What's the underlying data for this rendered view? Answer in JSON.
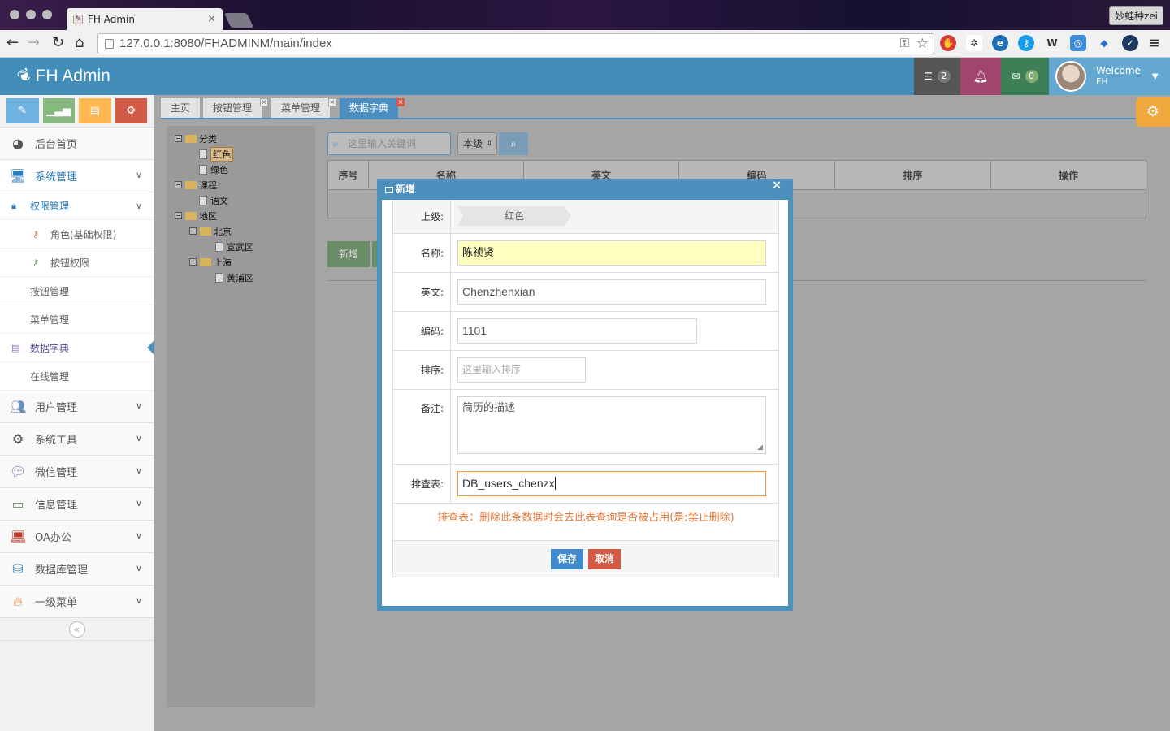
{
  "browser": {
    "tab_title": "FH Admin",
    "tab_close": "×",
    "profile_name": "妙蛙种zei",
    "url": "127.0.0.1:8080/FHADMINM/main/index"
  },
  "navbar": {
    "brand": "FH Admin",
    "tasks_count": "2",
    "messages_count": "0",
    "welcome": "Welcome",
    "username": "FH",
    "colors": {
      "bar": "#438eb9",
      "tasks": "#555555",
      "bell": "#a0456e",
      "mail": "#3d7f56",
      "user": "#62a8d1"
    }
  },
  "sidebar": {
    "shortcuts": [
      {
        "icon": "pencil-icon",
        "color": "#6fb3e0"
      },
      {
        "icon": "signal-icon",
        "color": "#87b87f"
      },
      {
        "icon": "book-icon",
        "color": "#ffb752"
      },
      {
        "icon": "cogs-icon",
        "color": "#d15b47"
      }
    ],
    "home": "后台首页",
    "system": "系统管理",
    "permissions": "权限管理",
    "role": "角色(基础权限)",
    "button_perm": "按钮权限",
    "button_mgmt": "按钮管理",
    "menu_mgmt": "菜单管理",
    "dictionary": "数据字典",
    "online": "在线管理",
    "users": "用户管理",
    "tools": "系统工具",
    "wechat": "微信管理",
    "info": "信息管理",
    "oa": "OA办公",
    "database": "数据库管理",
    "level1": "一级菜单",
    "collapse_glyph": "«"
  },
  "tabs": [
    "主页",
    "按钮管理",
    "菜单管理",
    "数据字典"
  ],
  "tree": {
    "category": "分类",
    "red": "红色",
    "green": "绿色",
    "course": "课程",
    "chinese": "语文",
    "region": "地区",
    "beijing": "北京",
    "xuanwu": "宣武区",
    "shanghai": "上海",
    "huangpu": "黄浦区"
  },
  "search": {
    "placeholder": "这里输入关键词",
    "level": "本级"
  },
  "table": {
    "headers": [
      "序号",
      "名称",
      "英文",
      "编码",
      "排序",
      "操作"
    ]
  },
  "main_buttons": {
    "add": "新增"
  },
  "modal": {
    "title": "新增",
    "close": "×",
    "parent_label": "上级:",
    "parent_value": "红色",
    "name_label": "名称:",
    "name_value": "陈祯贤",
    "english_label": "英文:",
    "english_value": "Chenzhenxian",
    "code_label": "编码:",
    "code_value": "1101",
    "order_label": "排序:",
    "order_placeholder": "这里输入排序",
    "remark_label": "备注:",
    "remark_value": "简历的描述",
    "check_table_label": "排查表:",
    "check_table_value": "DB_users_chenzx",
    "warning": "排查表：删除此条数据时会去此表查询是否被占用(是:禁止删除)",
    "save": "保存",
    "cancel": "取消"
  }
}
